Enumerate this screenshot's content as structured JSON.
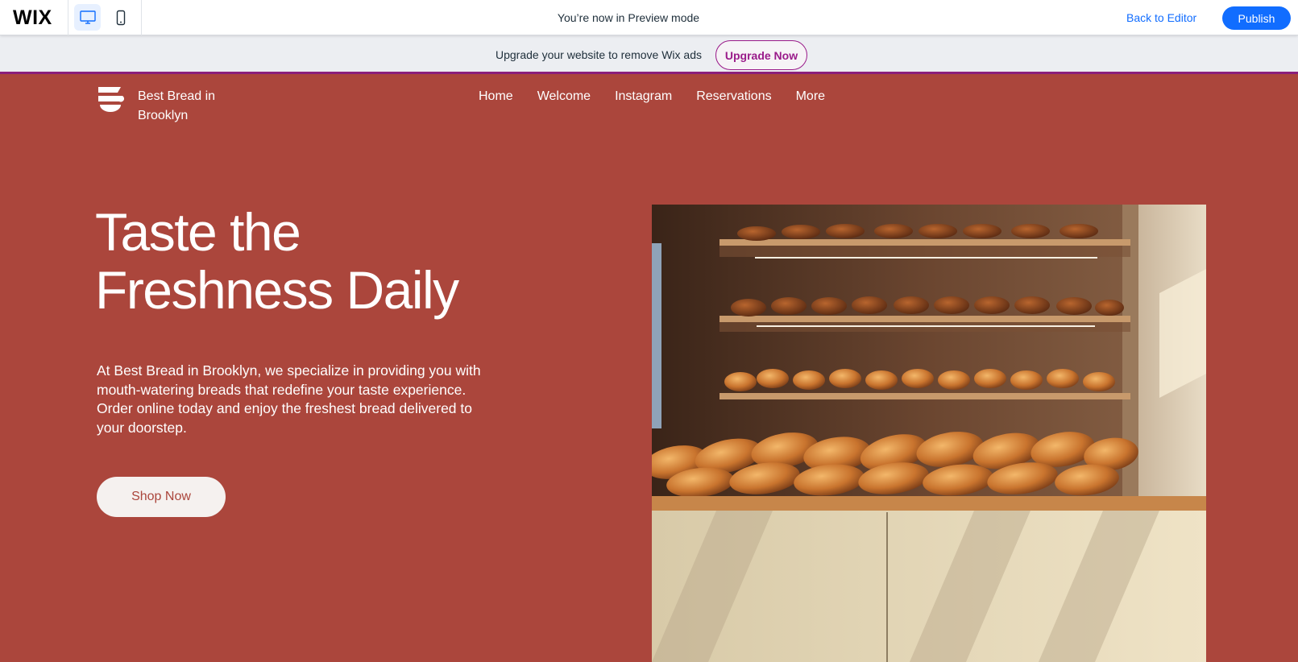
{
  "preview_bar": {
    "logo": "WIX",
    "mode_label": "You’re now in Preview mode",
    "back_to_editor": "Back to Editor",
    "publish": "Publish",
    "device_desktop_icon": "desktop-icon",
    "device_mobile_icon": "mobile-icon",
    "accent_color": "#116dff"
  },
  "upgrade_banner": {
    "text": "Upgrade your website to remove Wix ads",
    "button": "Upgrade Now",
    "accent_color": "#9a1b8a"
  },
  "site": {
    "name_line1": "Best Bread in",
    "name_line2": "Brooklyn",
    "logo_icon": "bread-logo-icon",
    "background_color": "#ab463c",
    "nav": [
      "Home",
      "Welcome",
      "Instagram",
      "Reservations",
      "More"
    ]
  },
  "hero": {
    "title_line1": "Taste the",
    "title_line2": "Freshness Daily",
    "description": "At Best Bread in Brooklyn, we specialize in providing you with mouth-watering breads that redefine your taste experience. Order online today and enjoy the freshest bread delivered to your doorstep.",
    "cta": "Shop Now",
    "image_subject": "bread-shelves-image"
  }
}
